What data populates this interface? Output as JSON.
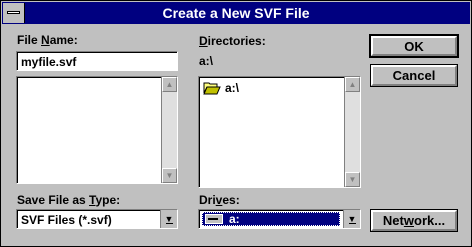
{
  "window": {
    "title": "Create a New SVF File"
  },
  "file_name": {
    "label_pre": "File ",
    "label_u": "N",
    "label_post": "ame:",
    "value": "myfile.svf",
    "list_items": []
  },
  "directories": {
    "label_u": "D",
    "label_post": "irectories:",
    "current_path": "a:\\",
    "items": [
      {
        "label": "a:\\",
        "icon": "open-folder-icon"
      }
    ]
  },
  "save_type": {
    "label_pre": "Save File as ",
    "label_u": "T",
    "label_post": "ype:",
    "selected": "SVF Files (*.svf)"
  },
  "drives": {
    "label_pre": "Dri",
    "label_u": "v",
    "label_post": "es:",
    "selected": "a:",
    "icon": "floppy-drive-icon"
  },
  "buttons": {
    "ok": "OK",
    "cancel": "Cancel",
    "network_pre": "Net",
    "network_u": "w",
    "network_post": "ork..."
  },
  "colors": {
    "titlebar": "#000080",
    "face": "#c0c0c0",
    "selection": "#000080"
  }
}
